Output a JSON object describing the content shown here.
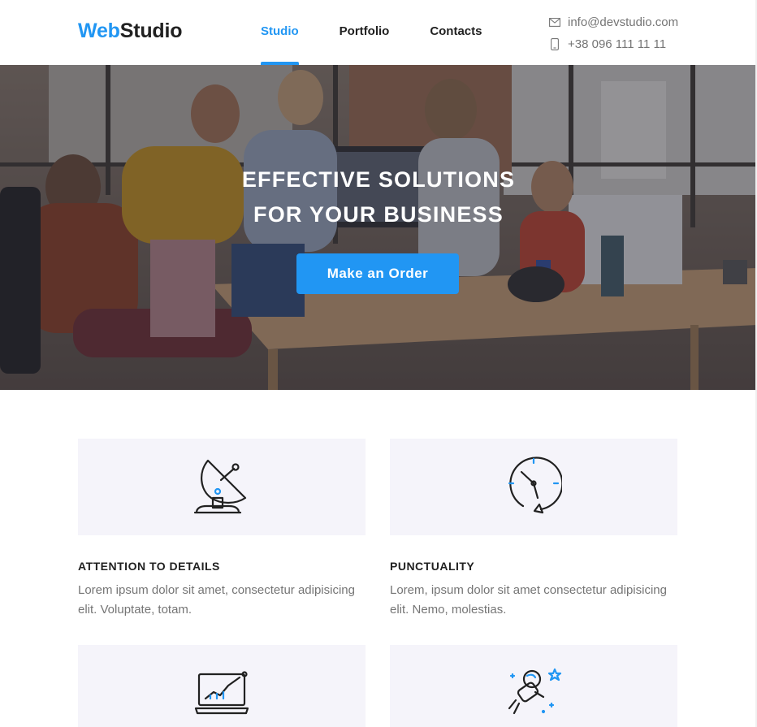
{
  "brand": {
    "part1": "Web",
    "part2": "Studio",
    "accent": "#2196f3"
  },
  "nav": {
    "items": [
      {
        "label": "Studio",
        "active": true
      },
      {
        "label": "Portfolio",
        "active": false
      },
      {
        "label": "Contacts",
        "active": false
      }
    ]
  },
  "contacts": {
    "email": "info@devstudio.com",
    "phone": "+38 096 111 11 11",
    "email_icon": "mail-icon",
    "phone_icon": "phone-icon"
  },
  "hero": {
    "title_line1": "EFFECTIVE SOLUTIONS",
    "title_line2": "FOR YOUR BUSINESS",
    "button_label": "Make an Order"
  },
  "features": [
    {
      "icon": "satellite-dish-icon",
      "title": "ATTENTION TO DETAILS",
      "text": "Lorem ipsum dolor sit amet, consectetur adipisicing elit. Voluptate, totam."
    },
    {
      "icon": "clock-icon",
      "title": "PUNCTUALITY",
      "text": "Lorem, ipsum dolor sit amet consectetur adipisicing elit. Nemo, molestias."
    },
    {
      "icon": "laptop-chart-icon",
      "title": "",
      "text": ""
    },
    {
      "icon": "astronaut-icon",
      "title": "",
      "text": ""
    }
  ]
}
